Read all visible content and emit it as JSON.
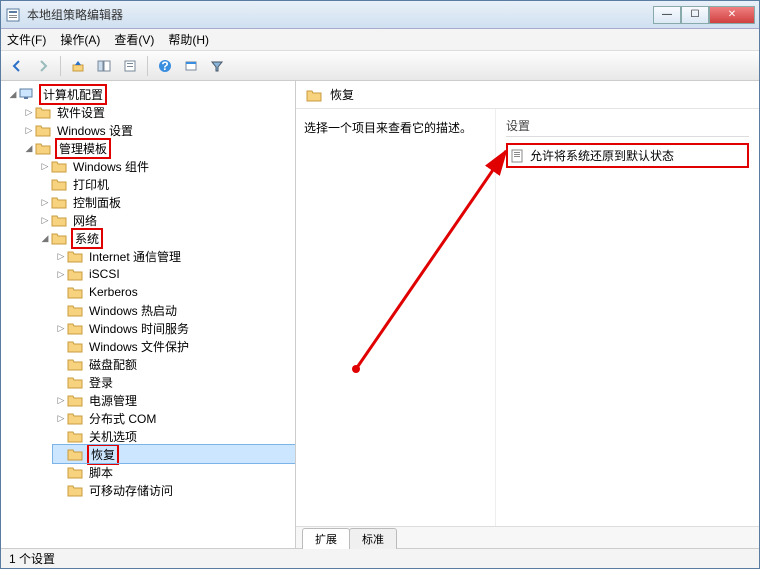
{
  "window": {
    "title": "本地组策略编辑器"
  },
  "menu": {
    "file": "文件(F)",
    "action": "操作(A)",
    "view": "查看(V)",
    "help": "帮助(H)"
  },
  "tree": {
    "root": "计算机配置",
    "software": "软件设置",
    "windows_settings": "Windows 设置",
    "admin_templates": "管理模板",
    "win_components": "Windows 组件",
    "printers": "打印机",
    "control_panel": "控制面板",
    "network": "网络",
    "system": "系统",
    "internet_comm": "Internet 通信管理",
    "iscsi": "iSCSI",
    "kerberos": "Kerberos",
    "win_hotstart": "Windows 热启动",
    "win_time": "Windows 时间服务",
    "win_fileprotect": "Windows 文件保护",
    "disk_quota": "磁盘配额",
    "logon": "登录",
    "power": "电源管理",
    "dcom": "分布式 COM",
    "shutdown_opts": "关机选项",
    "recovery": "恢复",
    "scripts": "脚本",
    "removable": "可移动存储访问"
  },
  "detail": {
    "crumb": "恢复",
    "prompt": "选择一个项目来查看它的描述。",
    "col_setting": "设置",
    "item1": "允许将系统还原到默认状态",
    "tab_ext": "扩展",
    "tab_std": "标准"
  },
  "status": {
    "text": "1 个设置"
  }
}
